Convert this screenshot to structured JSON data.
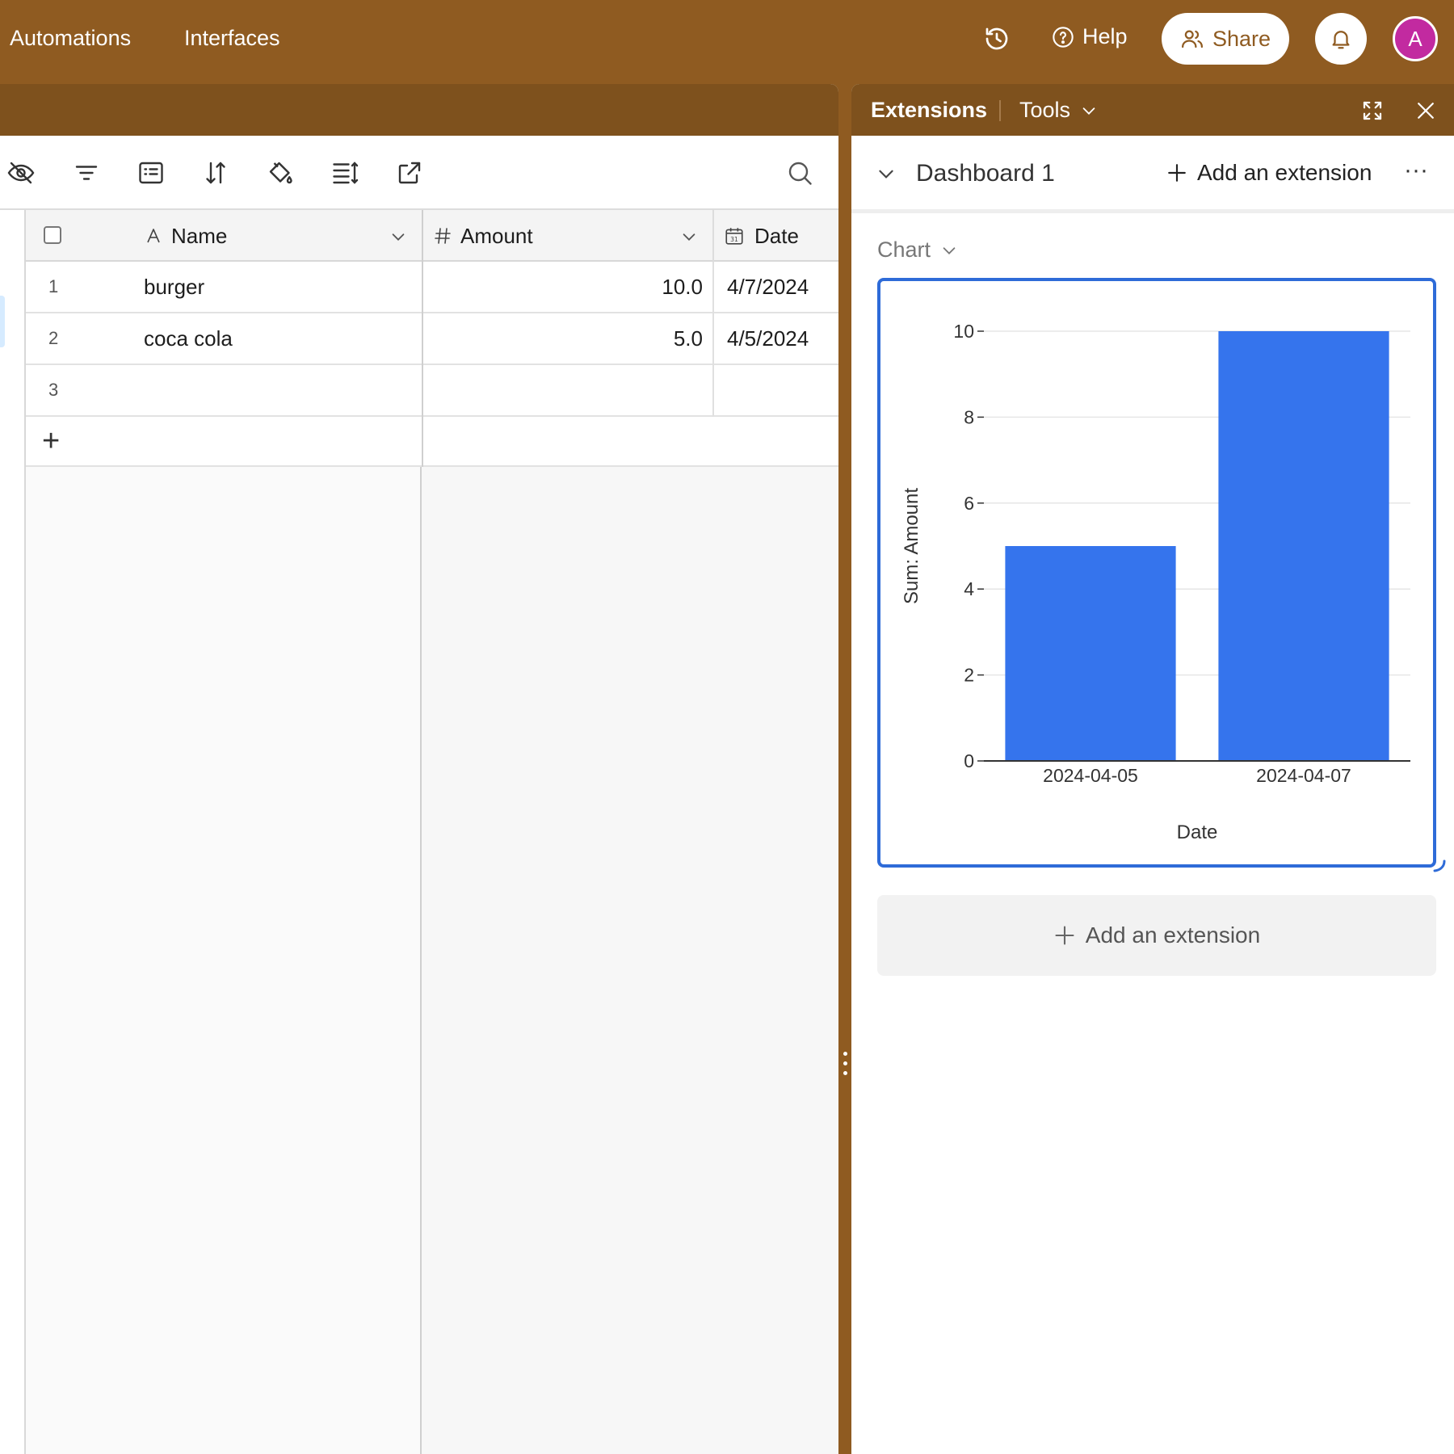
{
  "topbar": {
    "nav": [
      "Automations",
      "Interfaces"
    ],
    "help_label": "Help",
    "share_label": "Share",
    "avatar_initial": "A"
  },
  "grid": {
    "columns": [
      {
        "name": "Name",
        "icon": "text-field-icon"
      },
      {
        "name": "Amount",
        "icon": "number-field-icon"
      },
      {
        "name": "Date",
        "icon": "calendar-icon"
      }
    ],
    "rows": [
      {
        "num": "1",
        "name": "burger",
        "amount": "10.0",
        "date": "4/7/2024"
      },
      {
        "num": "2",
        "name": "coca cola",
        "amount": "5.0",
        "date": "4/5/2024"
      },
      {
        "num": "3",
        "name": "",
        "amount": "",
        "date": ""
      }
    ],
    "add_row_symbol": "+"
  },
  "extensions": {
    "title": "Extensions",
    "tools_label": "Tools",
    "dashboard_name": "Dashboard 1",
    "add_extension_label": "Add an extension",
    "more_symbol": "···",
    "chart_label": "Chart"
  },
  "chart_data": {
    "type": "bar",
    "categories": [
      "2024-04-05",
      "2024-04-07"
    ],
    "values": [
      5,
      10
    ],
    "xlabel": "Date",
    "ylabel": "Sum: Amount",
    "ylim": [
      0,
      10
    ],
    "yticks": [
      0,
      2,
      4,
      6,
      8,
      10
    ],
    "grid": true,
    "color": "#3574ed"
  },
  "colors": {
    "brand": "#8f5b21",
    "accent": "#2e6bd8",
    "avatar": "#c22aa0"
  }
}
